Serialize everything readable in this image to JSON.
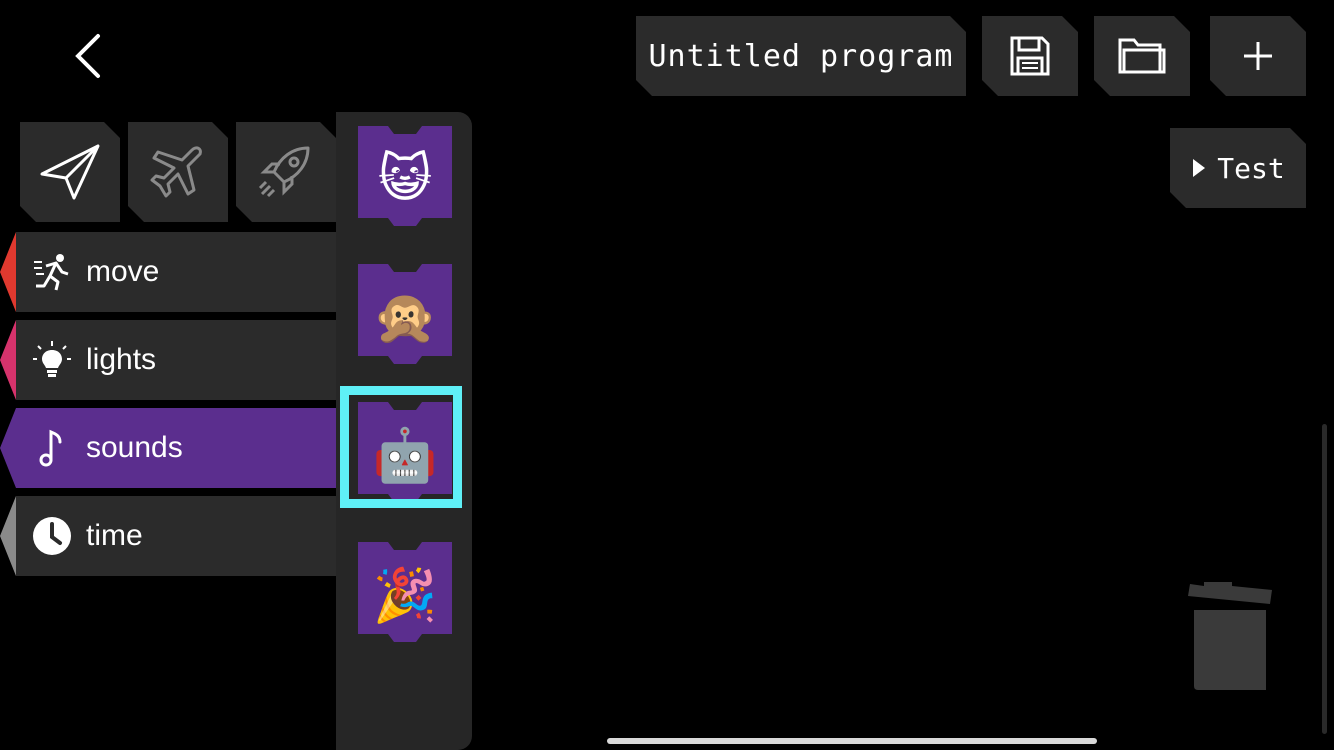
{
  "header": {
    "program_title": "Untitled program",
    "back_icon": "chevron-left-icon",
    "save_icon": "save-icon",
    "open_icon": "folder-icon",
    "add_icon": "plus-icon",
    "test_label": "Test"
  },
  "vehicles": [
    "paper-plane-icon",
    "airplane-icon",
    "rocket-icon"
  ],
  "categories": [
    {
      "label": "move",
      "icon": "running-icon",
      "color": "#e0392f"
    },
    {
      "label": "lights",
      "icon": "lightbulb-icon",
      "color": "#d6336c"
    },
    {
      "label": "sounds",
      "icon": "music-note-icon",
      "color": "#5b2e8e",
      "active": true
    },
    {
      "label": "time",
      "icon": "clock-icon",
      "color": "#8a8a8a"
    }
  ],
  "palette_blocks": [
    {
      "emoji": "😺",
      "name": "cat"
    },
    {
      "emoji": "🙊",
      "name": "monkey"
    },
    {
      "emoji": "🤖",
      "name": "robot",
      "selected": true
    },
    {
      "emoji": "🎉",
      "name": "party-popper"
    }
  ],
  "colors": {
    "accent_purple": "#5b2e8e",
    "selection": "#5ff0f7",
    "tile": "#2b2b2b"
  },
  "trash_icon": "trash-icon"
}
